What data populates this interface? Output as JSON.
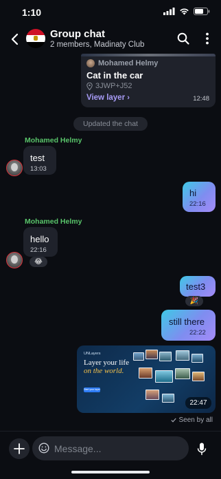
{
  "status_bar": {
    "time": "1:10"
  },
  "header": {
    "title": "Group chat",
    "subtitle": "2 members, Madinaty Club",
    "flag_colors": [
      "#ce1126",
      "#ffffff",
      "#000000"
    ]
  },
  "location_card": {
    "sender": "Mohamed Helmy",
    "title": "Cat in the car",
    "plus_code": "3JWP+J52",
    "link_label": "View layer",
    "time": "12:48"
  },
  "system_message": "Updated the chat",
  "messages": [
    {
      "sender": "Mohamed Helmy",
      "text": "test",
      "time": "13:03",
      "direction": "in"
    },
    {
      "text": "hi",
      "time": "22:16",
      "direction": "out"
    },
    {
      "sender": "Mohamed Helmy",
      "text": "hello",
      "time": "22:16",
      "direction": "in",
      "reaction": "😂"
    },
    {
      "text": "test3",
      "direction": "out",
      "reaction": "🎉"
    },
    {
      "text": "still there",
      "time": "22:22",
      "direction": "out"
    }
  ],
  "image_message": {
    "brand": "UNLayers",
    "headline": "Layer your life",
    "headline_accent": "on the world.",
    "cta": "Start your layer",
    "time": "22:47"
  },
  "seen_label": "Seen by all",
  "composer": {
    "placeholder": "Message..."
  },
  "colors": {
    "background": "#0b0d12",
    "bubble_in": "#1f222b",
    "sender_name": "#59c46a",
    "link": "#a89cf7",
    "bubble_out_start": "#3ec9e6",
    "bubble_out_end": "#a48bf7"
  },
  "icons": {
    "back": "chevron-left-icon",
    "search": "search-icon",
    "menu": "more-vertical-icon",
    "add": "plus-icon",
    "emoji": "emoji-icon",
    "mic": "microphone-icon",
    "pin": "location-pin-icon",
    "seen": "check-icon"
  }
}
